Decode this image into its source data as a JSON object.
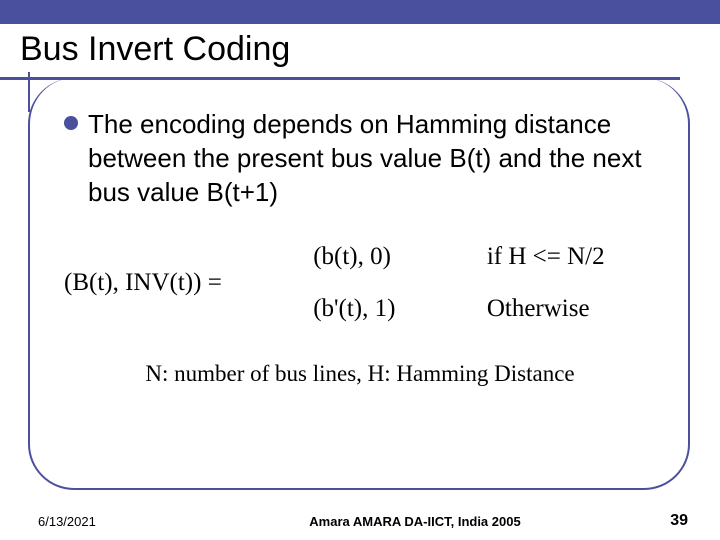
{
  "title": "Bus Invert Coding",
  "bullet": {
    "text": "The encoding depends on Hamming distance between the present bus value B(t) and the next bus value B(t+1)"
  },
  "formula": {
    "left": "(B(t), INV(t)) =",
    "case1": "(b(t), 0)",
    "cond1": "if H <= N/2",
    "case2": "(b'(t), 1)",
    "cond2": "Otherwise"
  },
  "note": "N: number of bus lines, H: Hamming Distance",
  "footer": {
    "date": "6/13/2021",
    "center": "Amara AMARA DA-IICT, India 2005",
    "page": "39"
  }
}
